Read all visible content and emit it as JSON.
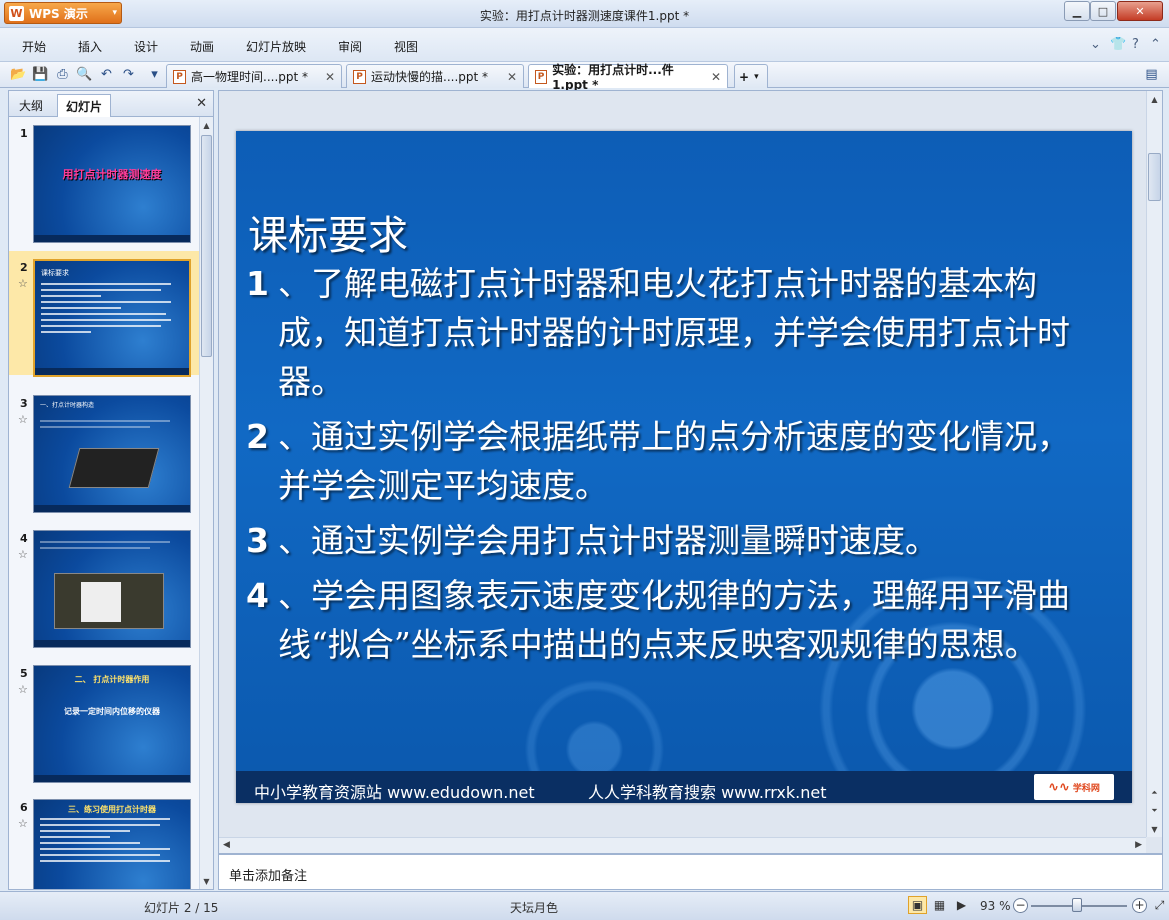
{
  "app": {
    "name": "WPS 演示",
    "logo": "W"
  },
  "window": {
    "title": "实验：用打点计时器测速度课件1.ppt *"
  },
  "menu": [
    "开始",
    "插入",
    "设计",
    "动画",
    "幻灯片放映",
    "审阅",
    "视图"
  ],
  "doc_tabs": [
    {
      "label": "高一物理时间....ppt *",
      "active": false
    },
    {
      "label": "运动快慢的描....ppt *",
      "active": false
    },
    {
      "label": "实验：用打点计时...件1.ppt *",
      "active": true
    }
  ],
  "panel": {
    "tab_outline": "大纲",
    "tab_slides": "幻灯片"
  },
  "thumbnails": [
    {
      "num": "1",
      "title": "用打点计时器测速度"
    },
    {
      "num": "2",
      "title": "课标要求"
    },
    {
      "num": "3",
      "title": "一、打点计时器构造"
    },
    {
      "num": "4",
      "title": ""
    },
    {
      "num": "5",
      "title": "二、 打点计时器作用",
      "subtitle": "记录一定时间内位移的仪器"
    },
    {
      "num": "6",
      "title": "三、练习使用打点计时器"
    }
  ],
  "slide": {
    "heading": "课标要求",
    "items": [
      {
        "num": "1",
        "text": "、了解电磁打点计时器和电火花打点计时器的基本构成，知道打点计时器的计时原理，并学会使用打点计时器。"
      },
      {
        "num": "2",
        "text": "、通过实例学会根据纸带上的点分析速度的变化情况，并学会测定平均速度。"
      },
      {
        "num": "3",
        "text": "、通过实例学会用打点计时器测量瞬时速度。"
      },
      {
        "num": "4",
        "text": "、学会用图象表示速度变化规律的方法，理解用平滑曲线“拟合”坐标系中描出的点来反映客观规律的思想。"
      }
    ],
    "footer_left": "中小学教育资源站 www.edudown.net",
    "footer_right": "人人学科教育搜索  www.rrxk.net",
    "logo_text": "学科网"
  },
  "notes_placeholder": "单击添加备注",
  "status": {
    "slide_counter": "幻灯片 2 / 15",
    "theme": "天坛月色",
    "zoom": "93 %"
  },
  "colors": {
    "slide_bg": "#0d5db6",
    "accent": "#e0701a",
    "selected_thumb": "#fde8a8"
  }
}
